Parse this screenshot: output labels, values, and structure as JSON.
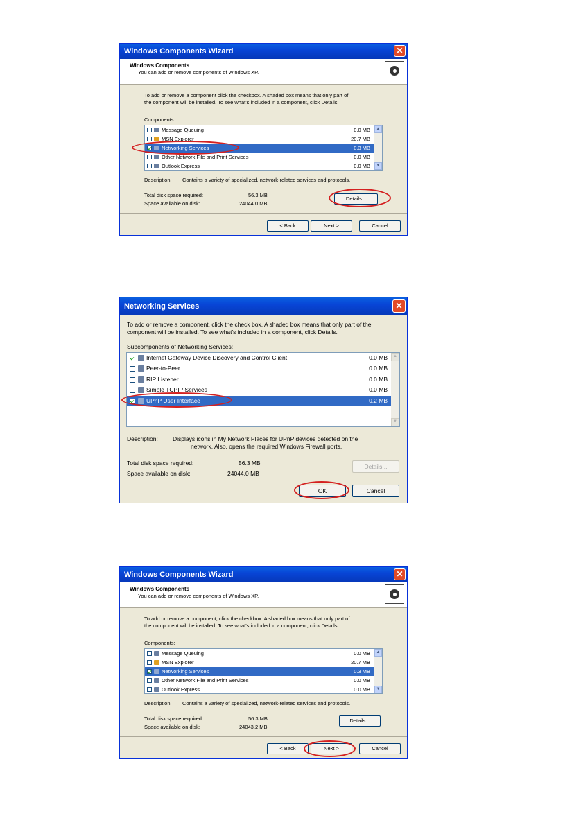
{
  "wizard1": {
    "title": "Windows Components Wizard",
    "header_title": "Windows Components",
    "header_sub": "You can add or remove components of Windows XP.",
    "intro": [
      "To add or remove a component click the checkbox. A shaded box means that only part of",
      "the component will be installed. To see what's included in a component, click Details."
    ],
    "components_label": "Components:",
    "items": [
      {
        "label": "Message Queuing",
        "size": "0.0 MB",
        "checked": false
      },
      {
        "label": "MSN Explorer",
        "size": "20.7 MB",
        "checked": false
      },
      {
        "label": "Networking Services",
        "size": "0.3 MB",
        "checked": true
      },
      {
        "label": "Other Network File and Print Services",
        "size": "0.0 MB",
        "checked": false
      },
      {
        "label": "Outlook Express",
        "size": "0.0 MB",
        "checked": false
      }
    ],
    "description_label": "Description:",
    "description": "Contains a variety of specialized, network-related services and protocols.",
    "total_label": "Total disk space required:",
    "total_value": "56.3 MB",
    "avail_label": "Space available on disk:",
    "avail_value": "24044.0 MB",
    "details": "Details...",
    "back": "< Back",
    "next": "Next >",
    "cancel": "Cancel"
  },
  "netservices": {
    "title": "Networking Services",
    "intro": [
      "To add or remove a component, click the check box. A shaded box means that only part of the",
      "component will be installed. To see what's included in a component, click Details."
    ],
    "sub_label": "Subcomponents of Networking Services:",
    "items": [
      {
        "label": "Internet Gateway Device Discovery and Control Client",
        "size": "0.0 MB",
        "checked": true
      },
      {
        "label": "Peer-to-Peer",
        "size": "0.0 MB",
        "checked": false
      },
      {
        "label": "RIP Listener",
        "size": "0.0 MB",
        "checked": false
      },
      {
        "label": "Simple TCPIP Services",
        "size": "0.0 MB",
        "checked": false
      },
      {
        "label": "UPnP User Interface",
        "size": "0.2 MB",
        "checked": true
      }
    ],
    "description_label": "Description:",
    "description": [
      "Displays icons in My Network Places for UPnP devices detected on the",
      "network. Also, opens the required Windows Firewall ports."
    ],
    "total_label": "Total disk space required:",
    "total_value": "56.3 MB",
    "avail_label": "Space available on disk:",
    "avail_value": "24044.0 MB",
    "details": "Details...",
    "ok": "OK",
    "cancel": "Cancel"
  },
  "wizard2": {
    "title": "Windows Components Wizard",
    "header_title": "Windows Components",
    "header_sub": "You can add or remove components of Windows XP.",
    "intro": [
      "To add or remove a component, click the checkbox. A shaded box means that only part of",
      "the component will be installed. To see what's included in a component, click Details."
    ],
    "components_label": "Components:",
    "items": [
      {
        "label": "Message Queuing",
        "size": "0.0 MB",
        "checked": false
      },
      {
        "label": "MSN Explorer",
        "size": "20.7 MB",
        "checked": false
      },
      {
        "label": "Networking Services",
        "size": "0.3 MB",
        "checked": true
      },
      {
        "label": "Other Network File and Print Services",
        "size": "0.0 MB",
        "checked": false
      },
      {
        "label": "Outlook Express",
        "size": "0.0 MB",
        "checked": false
      }
    ],
    "description_label": "Description:",
    "description": "Contains a variety of specialized, network-related services and protocols.",
    "total_label": "Total disk space required:",
    "total_value": "56.3 MB",
    "avail_label": "Space available on disk:",
    "avail_value": "24043.2 MB",
    "details": "Details...",
    "back": "< Back",
    "next": "Next >",
    "cancel": "Cancel"
  }
}
